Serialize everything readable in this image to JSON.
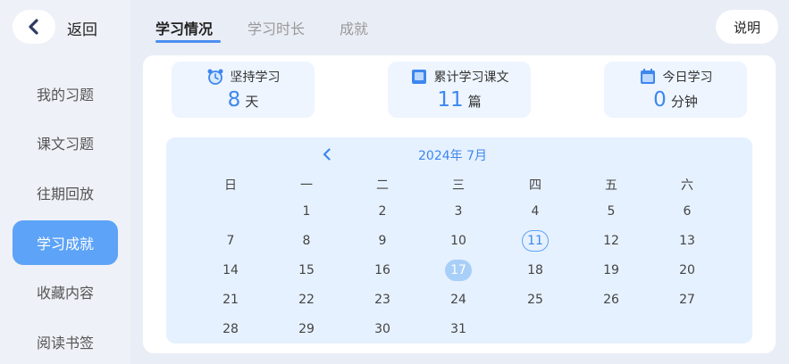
{
  "sidebar": {
    "back_label": "返回",
    "items": [
      {
        "label": "我的习题"
      },
      {
        "label": "课文习题"
      },
      {
        "label": "往期回放"
      },
      {
        "label": "学习成就"
      },
      {
        "label": "收藏内容"
      },
      {
        "label": "阅读书签"
      }
    ]
  },
  "tabs": [
    {
      "label": "学习情况"
    },
    {
      "label": "学习时长"
    },
    {
      "label": "成就"
    }
  ],
  "help_label": "说明",
  "stats": [
    {
      "title": "坚持学习",
      "value": "8",
      "unit": "天",
      "icon": "alarm-clock-icon"
    },
    {
      "title": "累计学习课文",
      "value": "11",
      "unit": "篇",
      "icon": "book-icon"
    },
    {
      "title": "今日学习",
      "value": "0",
      "unit": "分钟",
      "icon": "calendar-icon"
    }
  ],
  "calendar": {
    "title": "2024年 7月",
    "weekdays": [
      "日",
      "一",
      "二",
      "三",
      "四",
      "五",
      "六"
    ],
    "weeks": [
      [
        "",
        "1",
        "2",
        "3",
        "4",
        "5",
        "6"
      ],
      [
        "7",
        "8",
        "9",
        "10",
        "11",
        "12",
        "13"
      ],
      [
        "14",
        "15",
        "16",
        "17",
        "18",
        "19",
        "20"
      ],
      [
        "21",
        "22",
        "23",
        "24",
        "25",
        "26",
        "27"
      ],
      [
        "28",
        "29",
        "30",
        "31",
        "",
        "",
        ""
      ]
    ],
    "today": "11",
    "selected": "17"
  },
  "colors": {
    "accent": "#3d87ee",
    "active_item": "#5da3f7",
    "calendar_bg": "#e6f1ff"
  }
}
